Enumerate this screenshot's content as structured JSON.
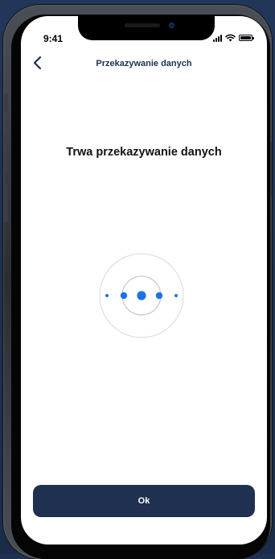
{
  "status_bar": {
    "time": "9:41"
  },
  "nav": {
    "title": "Przekazywanie danych",
    "back_icon": "chevron-left-icon"
  },
  "content": {
    "heading": "Trwa przekazywanie danych",
    "graphic_icon": "data-transfer-animation"
  },
  "actions": {
    "ok_label": "Ok"
  },
  "colors": {
    "navy": "#1f3050",
    "accent_blue": "#1a73e8",
    "ring_gray": "#d9d9d9"
  }
}
